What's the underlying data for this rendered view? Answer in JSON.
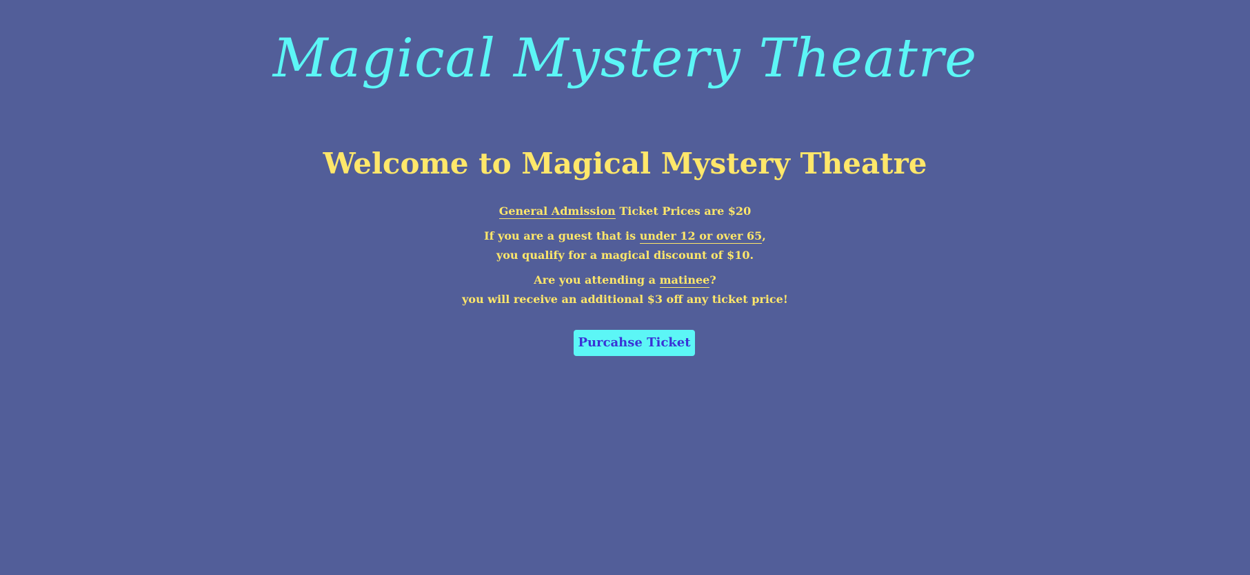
{
  "header": {
    "site_title": "Magical Mystery Theatre"
  },
  "main": {
    "welcome_heading": "Welcome to Magical Mystery Theatre",
    "pricing": {
      "general_admission_term": "General Admission",
      "price_text": " Ticket Prices are $20"
    },
    "discount": {
      "line1_prefix": "If you are a guest that is ",
      "age_term": "under 12 or over 65",
      "line1_suffix": ",",
      "line2": "you qualify for a magical discount of $10."
    },
    "matinee": {
      "line1_prefix": "Are you attending a ",
      "matinee_term": "matinee",
      "line1_suffix": "?",
      "line2": "you will receive an additional $3 off any ticket price!"
    },
    "purchase_button_label": "Purcahse Ticket"
  },
  "colors": {
    "background": "#525e99",
    "title": "#5cf6f6",
    "text": "#ffe76a",
    "button_bg": "#5cf6f6",
    "button_text": "#3a33d6"
  }
}
